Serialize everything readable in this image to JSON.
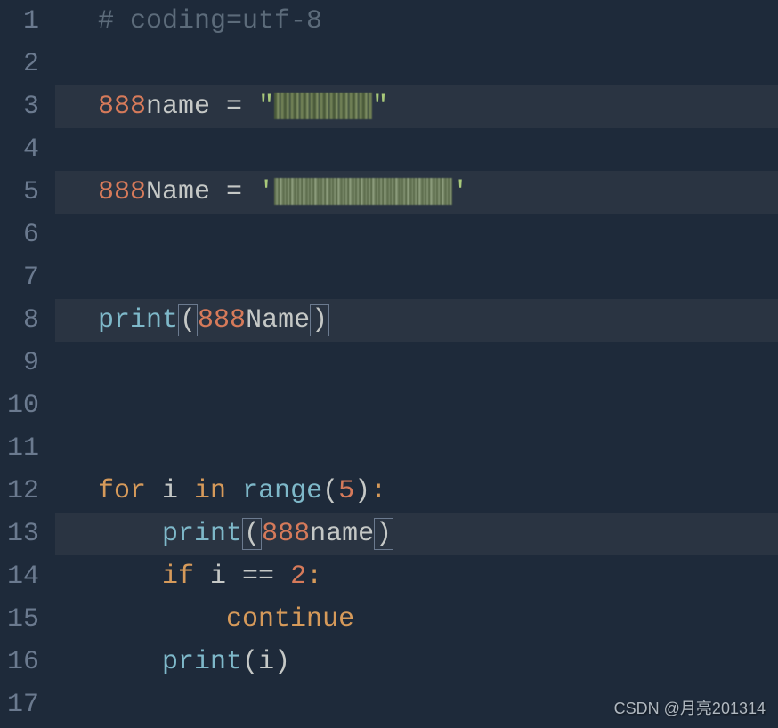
{
  "lines": {
    "1": {
      "num": "1",
      "comment": "# coding=utf-8"
    },
    "2": {
      "num": "2"
    },
    "3": {
      "num": "3",
      "n888": "888",
      "var": "name",
      "eq": " = ",
      "q1": "\"",
      "q2": "\""
    },
    "4": {
      "num": "4"
    },
    "5": {
      "num": "5",
      "n888": "888",
      "var": "Name",
      "eq": " = ",
      "q1": "'",
      "q2": "'"
    },
    "6": {
      "num": "6"
    },
    "7": {
      "num": "7"
    },
    "8": {
      "num": "8",
      "fn": "print",
      "lp": "(",
      "n888": "888",
      "var": "Name",
      "rp": ")"
    },
    "9": {
      "num": "9"
    },
    "10": {
      "num": "10"
    },
    "11": {
      "num": "11"
    },
    "12": {
      "num": "12",
      "kfor": "for",
      "i": " i ",
      "kin": "in",
      "range": " range",
      "lp": "(",
      "five": "5",
      "rp": ")",
      "colon": ":"
    },
    "13": {
      "num": "13",
      "indent": "    ",
      "fn": "print",
      "lp": "(",
      "n888": "888",
      "var": "name",
      "rp": ")"
    },
    "14": {
      "num": "14",
      "indent": "    ",
      "kif": "if",
      "cond": " i == ",
      "two": "2",
      "colon": ":"
    },
    "15": {
      "num": "15",
      "indent": "        ",
      "kcont": "continue"
    },
    "16": {
      "num": "16",
      "indent": "    ",
      "fn": "print",
      "lp": "(",
      "arg": "i",
      "rp": ")"
    },
    "17": {
      "num": "17"
    }
  },
  "watermark": "CSDN @月亮201314"
}
